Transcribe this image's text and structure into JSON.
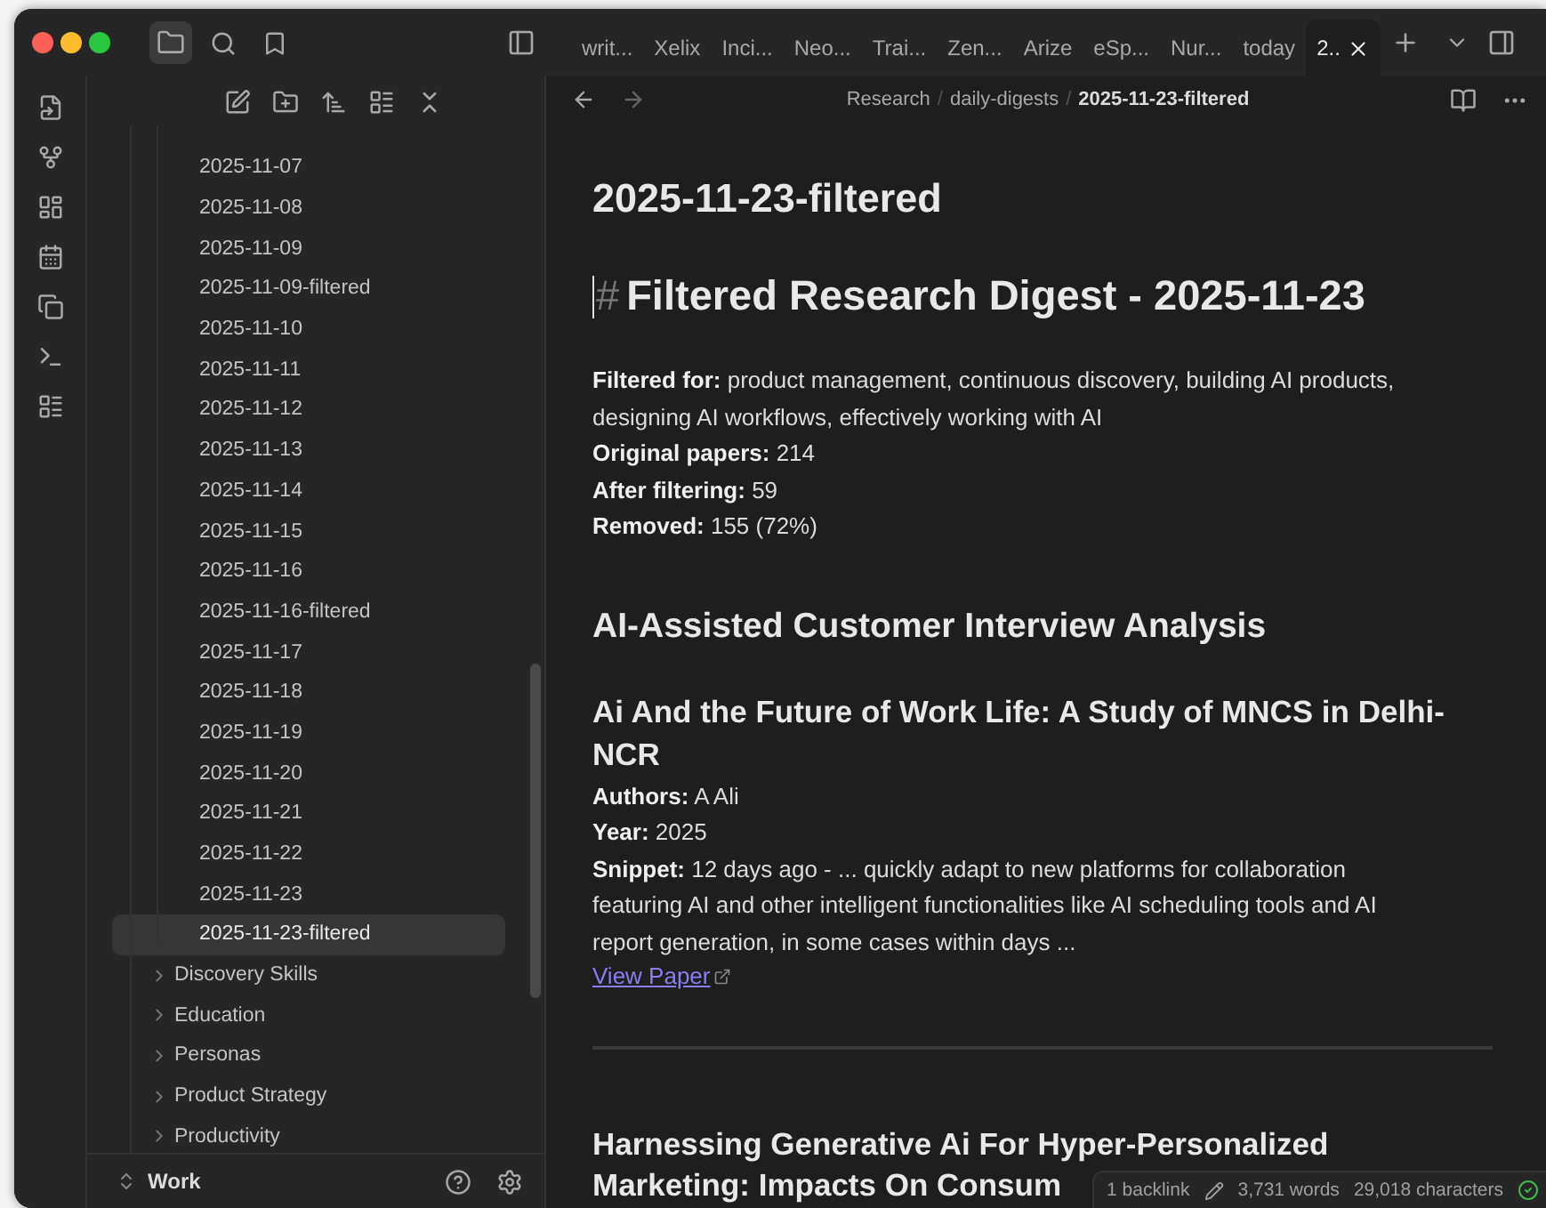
{
  "tabs": [
    {
      "label": "writ...",
      "selected": false
    },
    {
      "label": "Xelix",
      "selected": false
    },
    {
      "label": "Inci...",
      "selected": false
    },
    {
      "label": "Neo...",
      "selected": false
    },
    {
      "label": "Trai...",
      "selected": false
    },
    {
      "label": "Zen...",
      "selected": false
    },
    {
      "label": "Arize",
      "selected": false
    },
    {
      "label": "eSp...",
      "selected": false
    },
    {
      "label": "Nur...",
      "selected": false
    },
    {
      "label": "today",
      "selected": false
    },
    {
      "label": "2..",
      "selected": true
    }
  ],
  "sidebar": {
    "files": [
      {
        "label": "2025-11-07",
        "selected": false
      },
      {
        "label": "2025-11-08",
        "selected": false
      },
      {
        "label": "2025-11-09",
        "selected": false
      },
      {
        "label": "2025-11-09-filtered",
        "selected": false
      },
      {
        "label": "2025-11-10",
        "selected": false
      },
      {
        "label": "2025-11-11",
        "selected": false
      },
      {
        "label": "2025-11-12",
        "selected": false
      },
      {
        "label": "2025-11-13",
        "selected": false
      },
      {
        "label": "2025-11-14",
        "selected": false
      },
      {
        "label": "2025-11-15",
        "selected": false
      },
      {
        "label": "2025-11-16",
        "selected": false
      },
      {
        "label": "2025-11-16-filtered",
        "selected": false
      },
      {
        "label": "2025-11-17",
        "selected": false
      },
      {
        "label": "2025-11-18",
        "selected": false
      },
      {
        "label": "2025-11-19",
        "selected": false
      },
      {
        "label": "2025-11-20",
        "selected": false
      },
      {
        "label": "2025-11-21",
        "selected": false
      },
      {
        "label": "2025-11-22",
        "selected": false
      },
      {
        "label": "2025-11-23",
        "selected": false
      },
      {
        "label": "2025-11-23-filtered",
        "selected": true
      }
    ],
    "folders": [
      {
        "label": "Discovery Skills",
        "expanded": false
      },
      {
        "label": "Education",
        "expanded": false
      },
      {
        "label": "Personas",
        "expanded": false
      },
      {
        "label": "Product Strategy",
        "expanded": false
      },
      {
        "label": "Productivity",
        "expanded": false
      }
    ],
    "vault": "Work"
  },
  "breadcrumb": {
    "separator": "/",
    "items": [
      "Research",
      "daily-digests",
      "2025-11-23-filtered"
    ]
  },
  "note": {
    "title": "2025-11-23-filtered",
    "blocks": [
      {
        "kind": "h1",
        "marker": "#",
        "text": "Filtered Research Digest - 2025-11-23"
      },
      {
        "kind": "para",
        "lines": [
          "**Filtered for:** product management, continuous discovery, building AI products, designing AI workflows, effectively working with AI",
          "**Original papers:** 214",
          "**After filtering:** 59",
          "**Removed:** 155 (72%)"
        ]
      },
      {
        "kind": "h2",
        "text": "AI-Assisted Customer Interview Analysis"
      },
      {
        "kind": "h3",
        "text": "Ai And the Future of Work Life: A Study of MNCS in Delhi-NCR"
      },
      {
        "kind": "para",
        "lines": [
          "**Authors:** A Ali",
          "**Year:** 2025",
          "**Snippet:** 12 days ago - ... quickly adapt to new platforms for collaboration featuring AI and other intelligent functionalities like AI scheduling tools and AI report generation, in some cases within days ..."
        ]
      },
      {
        "kind": "link",
        "text": "View Paper"
      },
      {
        "kind": "hr"
      },
      {
        "kind": "h3_lines",
        "lines": [
          "Harnessing Generative Ai For Hyper-Personalized",
          "Marketing: Impacts On Consum"
        ]
      }
    ]
  },
  "status_bar": {
    "backlinks": "1 backlink",
    "words": "3,731 words",
    "characters": "29,018 characters"
  }
}
